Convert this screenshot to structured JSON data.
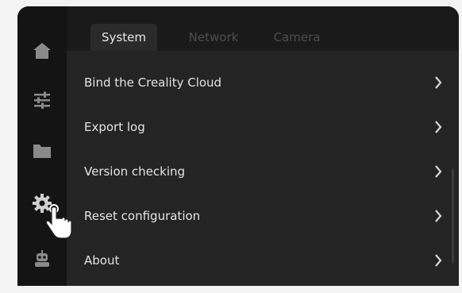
{
  "tabs": [
    {
      "label": "System",
      "active": true
    },
    {
      "label": "Network",
      "active": false
    },
    {
      "label": "Camera",
      "active": false
    }
  ],
  "sidebar": {
    "items": [
      {
        "icon": "home-icon"
      },
      {
        "icon": "sliders-icon"
      },
      {
        "icon": "folder-icon"
      },
      {
        "icon": "gear-icon",
        "active": true
      },
      {
        "icon": "robot-icon"
      }
    ]
  },
  "menu": {
    "items": [
      {
        "label": "Bind the Creality Cloud"
      },
      {
        "label": "Export log"
      },
      {
        "label": "Version checking"
      },
      {
        "label": "Reset configuration"
      },
      {
        "label": "About"
      }
    ]
  },
  "colors": {
    "sidebar_bg": "#141414",
    "content_bg": "#242424",
    "text": "#e4e4e4",
    "icon": "#8a8a8a"
  }
}
